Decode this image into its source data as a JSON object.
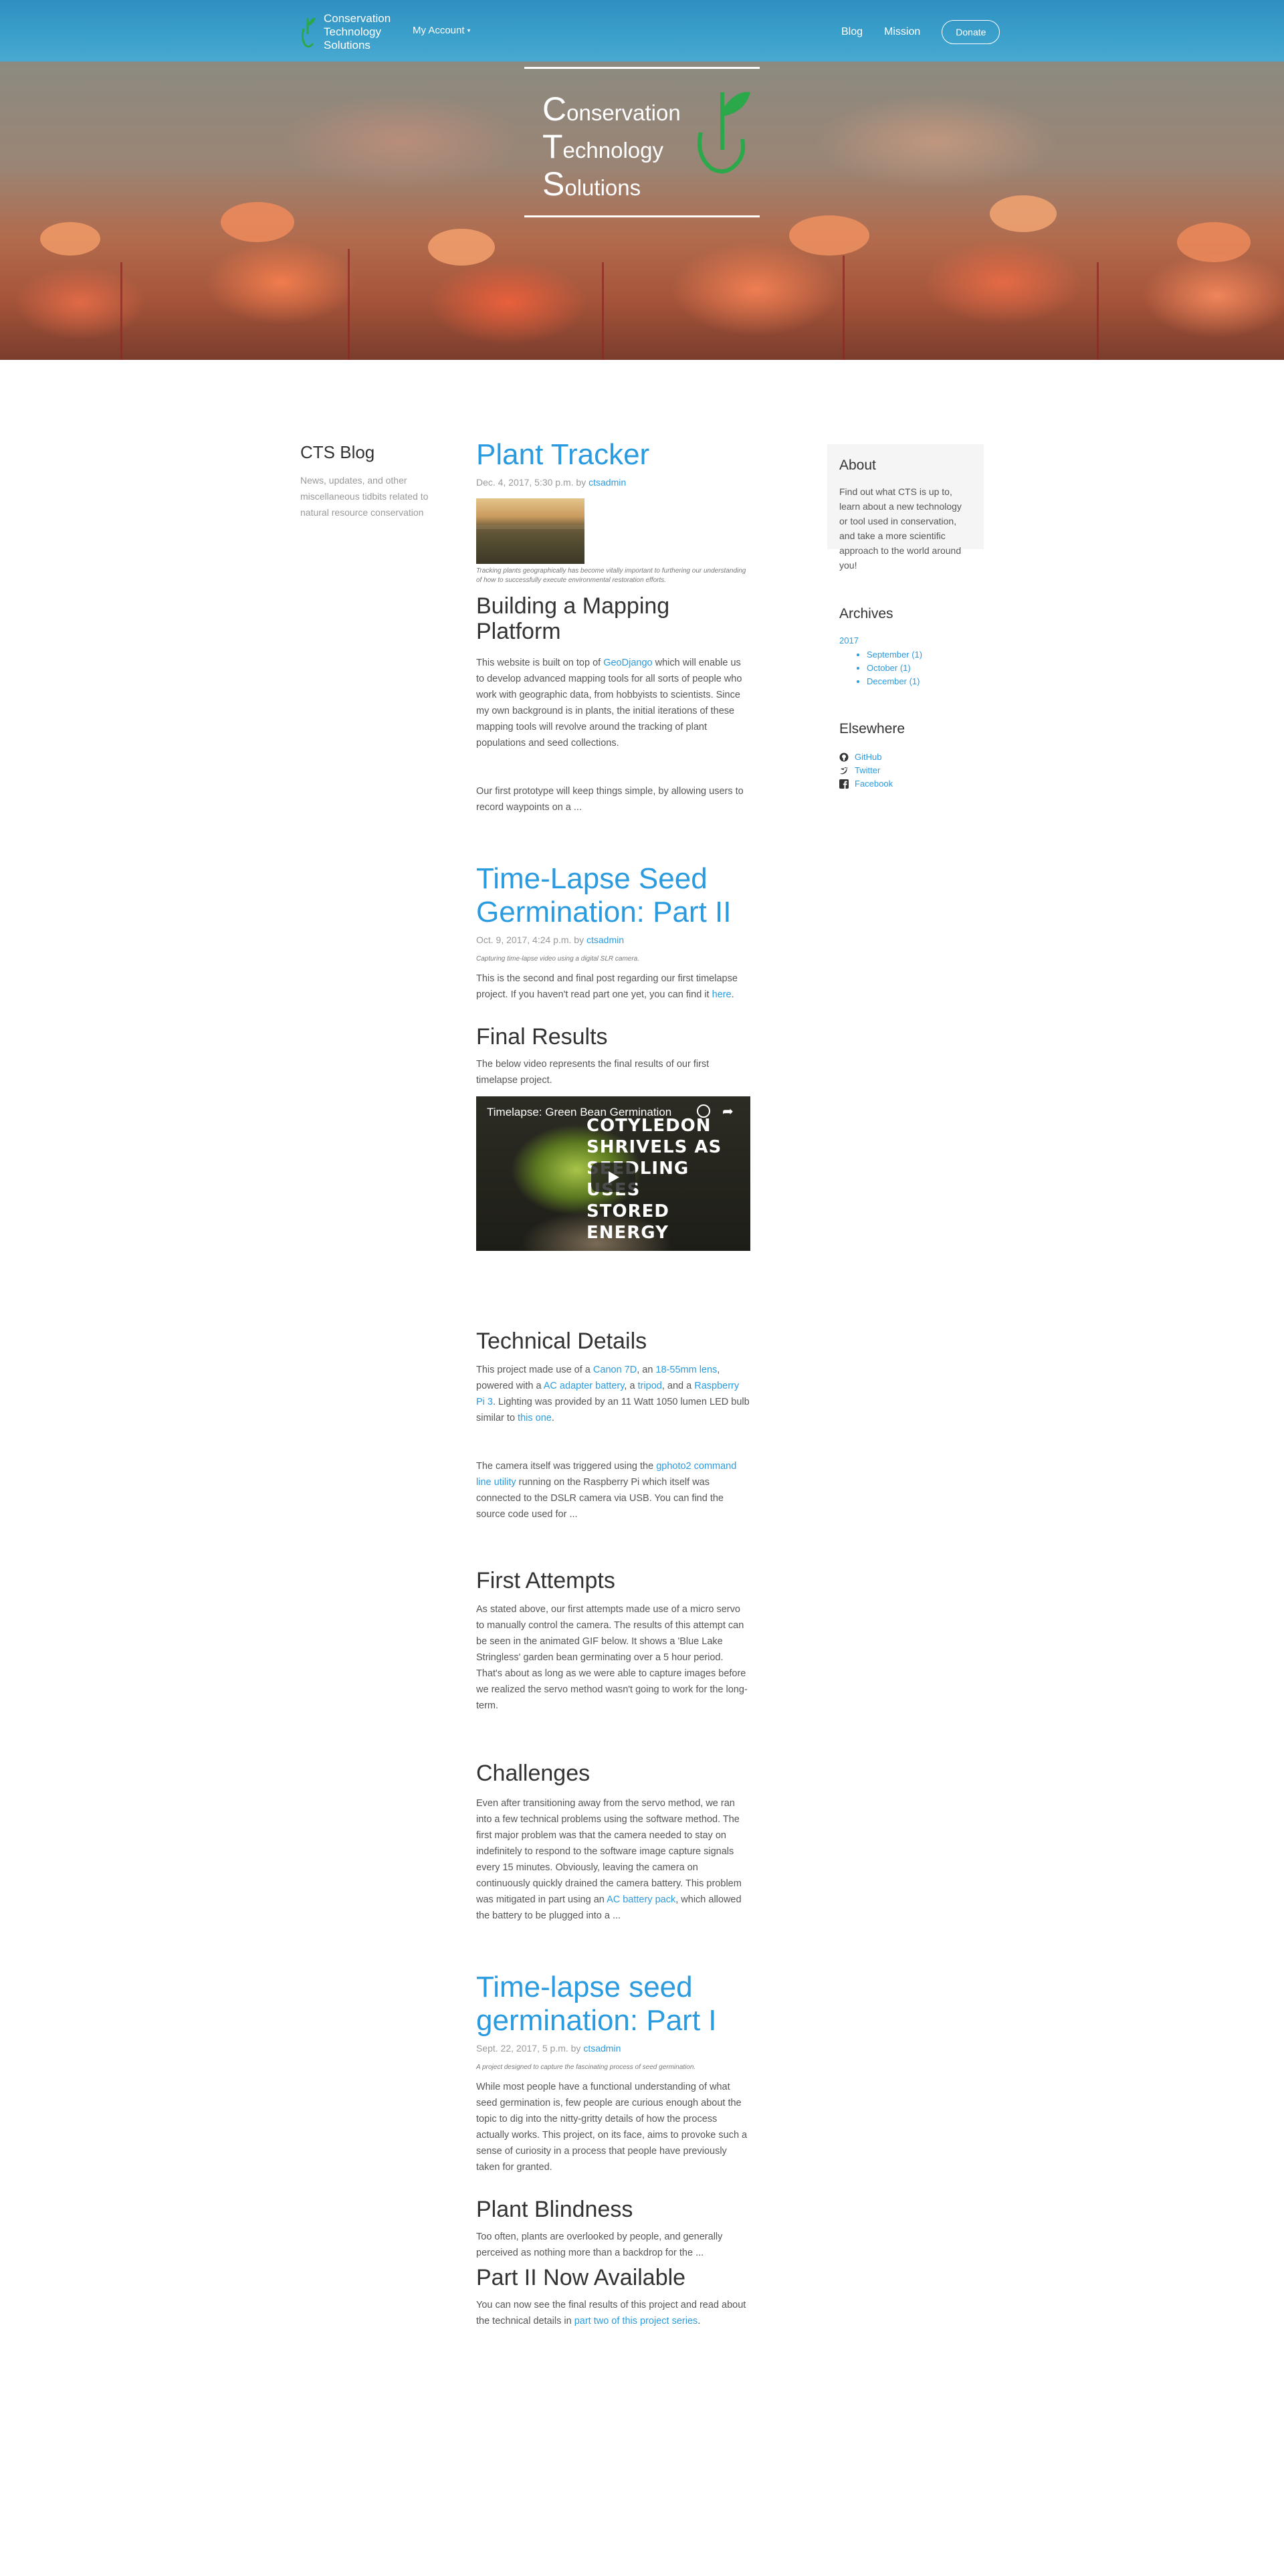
{
  "navbar": {
    "brand_lines": [
      "Conservation",
      "Technology",
      "Solutions"
    ],
    "account_label": "My Account",
    "blog_label": "Blog",
    "mission_label": "Mission",
    "donate_label": "Donate"
  },
  "hero": {
    "logo_lines": [
      {
        "cap": "C",
        "rest": "onservation"
      },
      {
        "cap": "T",
        "rest": "echnology"
      },
      {
        "cap": "S",
        "rest": "olutions"
      }
    ]
  },
  "left": {
    "title": "CTS Blog",
    "description": "News, updates, and other miscellaneous tidbits related to natural resource conservation"
  },
  "posts": {
    "p1": {
      "title": "Plant Tracker",
      "date": "Dec. 4, 2017, 5:30 p.m. by ",
      "author": "ctsadmin",
      "caption": "Tracking plants geographically has become vitally important to furthering our understanding of how to successfully execute environmental restoration efforts.",
      "h2": "Building a Mapping Platform",
      "para1_a": "This website is built on top of ",
      "para1_link": "GeoDjango",
      "para1_b": " which will enable us to develop advanced mapping tools for all sorts of people who work with geographic data, from hobbyists to scientists. Since my own background is in plants, the initial iterations of these mapping tools will revolve around the tracking of plant populations and seed collections.",
      "para2": "Our first prototype will keep things simple, by allowing users to record waypoints on a ..."
    },
    "p2": {
      "title": "Time-Lapse Seed Germination: Part II",
      "date": "Oct. 9, 2017, 4:24 p.m. by ",
      "author": "ctsadmin",
      "caption": "Capturing time-lapse video using a digital SLR camera.",
      "intro_a": "This is the second and final post regarding our first timelapse project. If you haven't read part one yet, you can find it ",
      "intro_link": "here",
      "intro_b": ".",
      "h2_results": "Final Results",
      "results_text": "The below video represents the final results of our first timelapse project.",
      "video_title": "Timelapse: Green Bean Germination",
      "video_overlay": "COTYLEDON SHRIVELS AS SEEDLING USES STORED ENERGY",
      "h2_tech": "Technical Details",
      "tech1_a": "This project made use of a ",
      "tech1_l1": "Canon 7D",
      "tech1_b": ", an ",
      "tech1_l2": "18-55mm lens",
      "tech1_c": ", powered with a ",
      "tech1_l3": "AC adapter battery",
      "tech1_d": ", a ",
      "tech1_l4": "tripod",
      "tech1_e": ", and a ",
      "tech1_l5": "Raspberry Pi 3",
      "tech1_f": ". Lighting was provided by an 11 Watt 1050 lumen LED bulb similar to ",
      "tech1_l6": "this one",
      "tech1_g": ".",
      "tech2_a": "The camera itself was triggered using the ",
      "tech2_link": "gphoto2 command line utility",
      "tech2_b": " running on the Raspberry Pi which itself was connected to the DSLR camera via USB. You can find the source code used for ...",
      "h2_first": "First Attempts",
      "first_text": "As stated above, our first attempts made use of a micro servo to manually control the camera. The results of this attempt can be seen in the animated GIF below. It shows a 'Blue Lake Stringless' garden bean germinating over a 5 hour period. That's about as long as we were able to capture images before we realized the servo method wasn't going to work for the long-term.",
      "h2_chal": "Challenges",
      "chal_a": "Even after transitioning away from the servo method, we ran into a few technical problems using the software method. The first major problem was that the camera needed to stay on indefinitely to respond to the software image capture signals every 15 minutes. Obviously, leaving the camera on continuously quickly drained the camera battery. This problem was mitigated in part using an ",
      "chal_link": "AC battery pack",
      "chal_b": ", which allowed the battery to be plugged into a ..."
    },
    "p3": {
      "title": "Time-lapse seed germination: Part I",
      "date": "Sept. 22, 2017, 5 p.m. by ",
      "author": "ctsadmin",
      "caption": "A project designed to capture the fascinating process of seed germination.",
      "intro": "While most people have a functional understanding of what seed germination is, few people are curious enough about the topic to dig into the nitty-gritty details of how the process actually works. This project, on its face, aims to provoke such a sense of curiosity in a process that people have previously taken for granted.",
      "h2_blind": "Plant Blindness",
      "blind_text": "Too often, plants are overlooked by people, and generally perceived as nothing more than a backdrop for the ...",
      "h2_part2": "Part II Now Available",
      "part2_a": "You can now see the final results of this project and read about the technical details in ",
      "part2_link": "part two of this project series",
      "part2_b": "."
    }
  },
  "sidebar": {
    "about_title": "About",
    "about_text": "Find out what CTS is up to, learn about a new technology or tool used in conservation, and take a more scientific approach to the world around you!",
    "archives_title": "Archives",
    "archives_year": "2017",
    "archives_months": [
      "September (1)",
      "October (1)",
      "December (1)"
    ],
    "elsewhere_title": "Elsewhere",
    "social": [
      {
        "label": "GitHub",
        "icon": "github-icon"
      },
      {
        "label": "Twitter",
        "icon": "twitter-icon"
      },
      {
        "label": "Facebook",
        "icon": "facebook-icon"
      }
    ]
  },
  "colors": {
    "link": "#2b9be0",
    "navbar": "#3ba0cc",
    "logo_green": "#2aa84a"
  }
}
